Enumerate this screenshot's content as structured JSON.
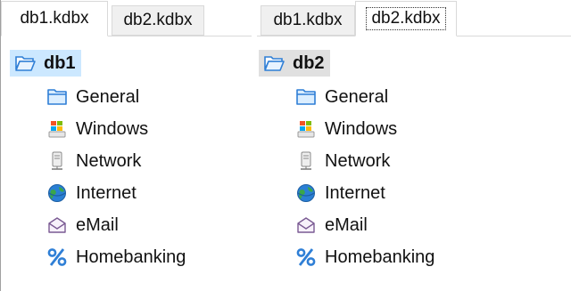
{
  "left": {
    "tabs": [
      {
        "label": "db1.kdbx",
        "active": true
      },
      {
        "label": "db2.kdbx",
        "active": false
      }
    ],
    "tree": {
      "root": {
        "label": "db1",
        "icon": "folder-open-icon"
      },
      "children": [
        {
          "label": "General",
          "icon": "folder-icon"
        },
        {
          "label": "Windows",
          "icon": "windows-icon"
        },
        {
          "label": "Network",
          "icon": "network-server-icon"
        },
        {
          "label": "Internet",
          "icon": "globe-icon"
        },
        {
          "label": "eMail",
          "icon": "email-icon"
        },
        {
          "label": "Homebanking",
          "icon": "percent-icon"
        }
      ]
    }
  },
  "right": {
    "tabs": [
      {
        "label": "db1.kdbx",
        "active": false
      },
      {
        "label": "db2.kdbx",
        "active": true
      }
    ],
    "tree": {
      "root": {
        "label": "db2",
        "icon": "folder-open-icon"
      },
      "children": [
        {
          "label": "General",
          "icon": "folder-icon"
        },
        {
          "label": "Windows",
          "icon": "windows-icon"
        },
        {
          "label": "Network",
          "icon": "network-server-icon"
        },
        {
          "label": "Internet",
          "icon": "globe-icon"
        },
        {
          "label": "eMail",
          "icon": "email-icon"
        },
        {
          "label": "Homebanking",
          "icon": "percent-icon"
        }
      ]
    }
  },
  "colors": {
    "selection_left": "#cce8ff",
    "selection_right": "#e0e0e0",
    "folder_blue": "#2f7fd6"
  }
}
